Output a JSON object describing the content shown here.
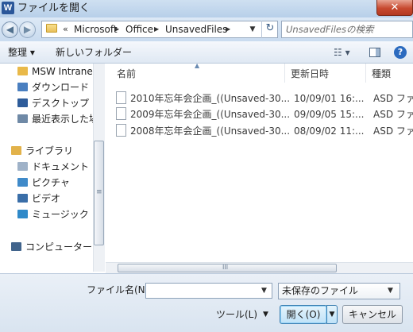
{
  "window": {
    "title": "ファイルを開く",
    "app_icon": "W",
    "close_glyph": "✕"
  },
  "nav": {
    "back_glyph": "◀",
    "forward_glyph": "▶",
    "breadcrumb_prefix": "«",
    "breadcrumbs": [
      "Microsoft",
      "Office",
      "UnsavedFiles"
    ],
    "separator": "▶",
    "dropdown_glyph": "▼",
    "refresh_glyph": "↻",
    "search_placeholder": "UnsavedFilesの検索"
  },
  "toolbar": {
    "organize_label": "整理 ▾",
    "new_folder_label": "新しいフォルダー",
    "views_label": "☷ ▾",
    "help_label": "?"
  },
  "sidebar": {
    "items": [
      {
        "label": "MSW Intranet",
        "icon": "network-folder-icon",
        "color": "#e9b949"
      },
      {
        "label": "ダウンロード",
        "icon": "download-folder-icon",
        "color": "#4a7fc0"
      },
      {
        "label": "デスクトップ",
        "icon": "desktop-icon",
        "color": "#2e5c9a"
      },
      {
        "label": "最近表示した場所",
        "icon": "recent-places-icon",
        "color": "#6f89a6"
      },
      {
        "label": "ライブラリ",
        "icon": "library-icon",
        "color": "#e2b24a"
      },
      {
        "label": "ドキュメント",
        "icon": "documents-icon",
        "color": "#9fb2c8"
      },
      {
        "label": "ピクチャ",
        "icon": "pictures-icon",
        "color": "#3f8ac9"
      },
      {
        "label": "ビデオ",
        "icon": "videos-icon",
        "color": "#3a6ea8"
      },
      {
        "label": "ミュージック",
        "icon": "music-icon",
        "color": "#2f89c9"
      },
      {
        "label": "コンピューター",
        "icon": "computer-icon",
        "color": "#41648c"
      }
    ],
    "scroll_grip": "≡"
  },
  "file_list": {
    "columns": [
      "名前",
      "更新日時",
      "種類"
    ],
    "sort_glyph": "▲",
    "rows": [
      {
        "name": "2010年忘年会企画_((Unsaved-30...",
        "modified": "10/09/01 16:...",
        "type": "ASD ファ"
      },
      {
        "name": "2009年忘年会企画_((Unsaved-30...",
        "modified": "09/09/05 15:...",
        "type": "ASD ファ"
      },
      {
        "name": "2008年忘年会企画_((Unsaved-30...",
        "modified": "08/09/02 11:...",
        "type": "ASD ファ"
      }
    ],
    "hscroll_grip": "III"
  },
  "bottom": {
    "filename_label": "ファイル名(N):",
    "filename_value": "",
    "filename_arrow": "▼",
    "filetype_value": "未保存のファイル",
    "filetype_arrow": "▼",
    "tools_label": "ツール(L)",
    "tools_arrow": "▼",
    "open_label": "開く(O)",
    "open_split_glyph": "▼",
    "cancel_label": "キャンセル"
  }
}
